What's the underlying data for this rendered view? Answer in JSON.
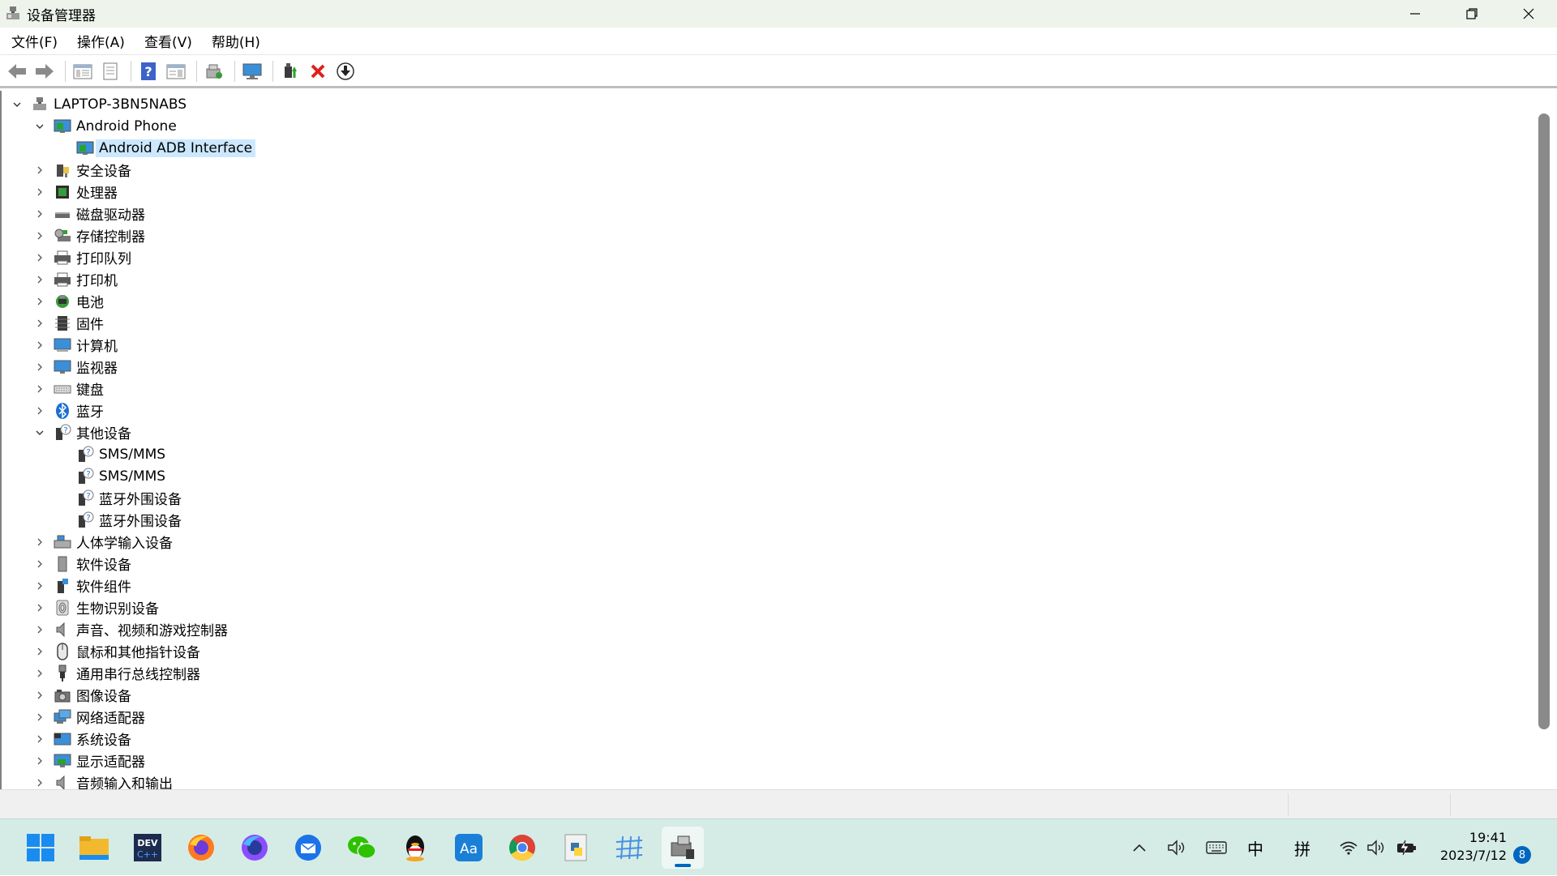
{
  "window": {
    "title": "设备管理器"
  },
  "menu": [
    "文件(F)",
    "操作(A)",
    "查看(V)",
    "帮助(H)"
  ],
  "toolbar": {
    "buttons": [
      "back",
      "forward",
      "show-hide-console-tree",
      "properties",
      "help",
      "action-pane",
      "scan-hardware",
      "display-monitor",
      "update-driver",
      "uninstall",
      "download"
    ]
  },
  "tree": {
    "root": "LAPTOP-3BN5NABS",
    "nodes": [
      {
        "label": "Android Phone",
        "expanded": true,
        "icon": "android-phone-icon",
        "children": [
          {
            "label": "Android ADB Interface",
            "selected": true,
            "icon": "android-phone-icon"
          }
        ]
      },
      {
        "label": "安全设备",
        "icon": "security-device-icon"
      },
      {
        "label": "处理器",
        "icon": "processor-icon"
      },
      {
        "label": "磁盘驱动器",
        "icon": "disk-drive-icon"
      },
      {
        "label": "存储控制器",
        "icon": "storage-controller-icon"
      },
      {
        "label": "打印队列",
        "icon": "print-queue-icon"
      },
      {
        "label": "打印机",
        "icon": "printer-icon"
      },
      {
        "label": "电池",
        "icon": "battery-icon"
      },
      {
        "label": "固件",
        "icon": "firmware-icon"
      },
      {
        "label": "计算机",
        "icon": "computer-icon"
      },
      {
        "label": "监视器",
        "icon": "monitor-icon"
      },
      {
        "label": "键盘",
        "icon": "keyboard-icon"
      },
      {
        "label": "蓝牙",
        "icon": "bluetooth-icon"
      },
      {
        "label": "其他设备",
        "expanded": true,
        "icon": "unknown-device-icon",
        "children": [
          {
            "label": "SMS/MMS",
            "icon": "unknown-device-icon"
          },
          {
            "label": "SMS/MMS",
            "icon": "unknown-device-icon"
          },
          {
            "label": "蓝牙外围设备",
            "icon": "unknown-device-icon"
          },
          {
            "label": "蓝牙外围设备",
            "icon": "unknown-device-icon"
          }
        ]
      },
      {
        "label": "人体学输入设备",
        "icon": "hid-icon"
      },
      {
        "label": "软件设备",
        "icon": "software-device-icon"
      },
      {
        "label": "软件组件",
        "icon": "software-component-icon"
      },
      {
        "label": "生物识别设备",
        "icon": "biometric-icon"
      },
      {
        "label": "声音、视频和游戏控制器",
        "icon": "sound-icon"
      },
      {
        "label": "鼠标和其他指针设备",
        "icon": "mouse-icon"
      },
      {
        "label": "通用串行总线控制器",
        "icon": "usb-icon"
      },
      {
        "label": "图像设备",
        "icon": "imaging-device-icon"
      },
      {
        "label": "网络适配器",
        "icon": "network-adapter-icon"
      },
      {
        "label": "系统设备",
        "icon": "system-device-icon"
      },
      {
        "label": "显示适配器",
        "icon": "display-adapter-icon"
      },
      {
        "label": "音频输入和输出",
        "icon": "audio-io-icon"
      }
    ]
  },
  "taskbar": {
    "apps": [
      "start",
      "file-explorer",
      "dev-cpp",
      "firefox",
      "firefox-nightly",
      "thunderbird",
      "wechat",
      "qq",
      "dictionary",
      "chrome",
      "python",
      "network-tool",
      "device-manager"
    ],
    "tray": {
      "ime_lang": "中",
      "ime_mode": "拼",
      "time": "19:41",
      "date": "2023/7/12",
      "notifications": "8"
    }
  },
  "colors": {
    "selection": "#cce8ff",
    "taskbar": "#d5ece6",
    "titlebar": "#eef4ec",
    "accent": "#0067c0"
  }
}
